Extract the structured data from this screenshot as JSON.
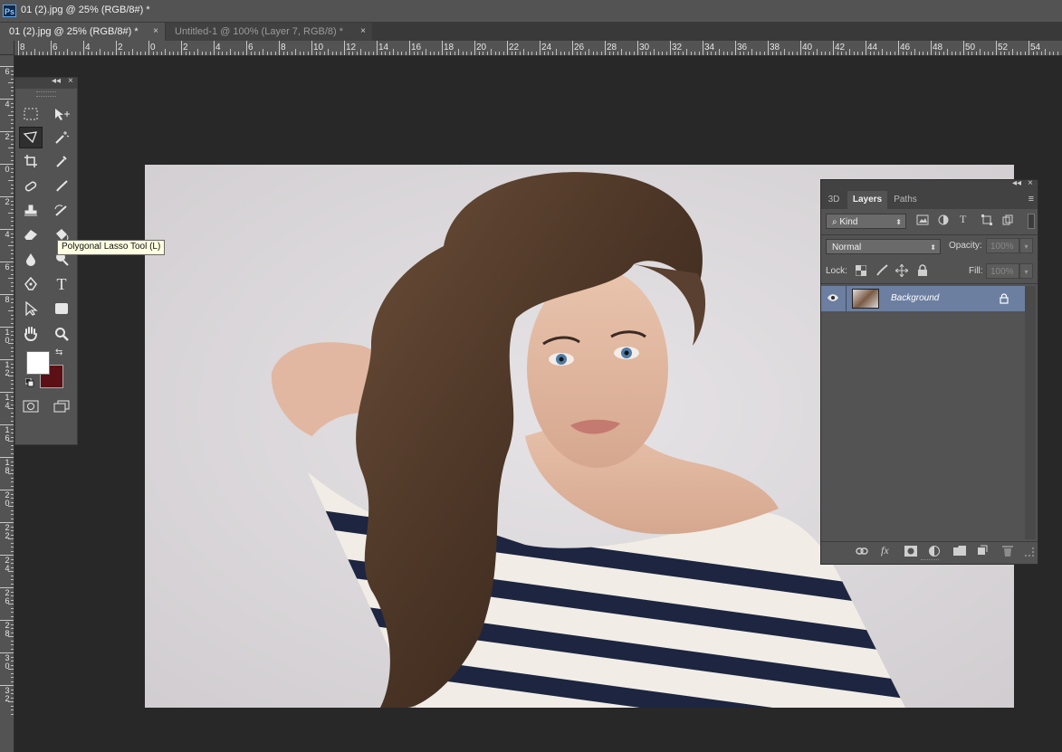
{
  "app": {
    "logo_text": "Ps",
    "window_title": "01 (2).jpg @ 25% (RGB/8#) *"
  },
  "tabs": [
    {
      "label": "01 (2).jpg @ 25% (RGB/8#) *",
      "close": "×",
      "active": true
    },
    {
      "label": "Untitled-1 @ 100% (Layer 7, RGB/8) *",
      "close": "×",
      "active": false
    }
  ],
  "rulers": {
    "top_labels": [
      "8",
      "6",
      "4",
      "2",
      "0",
      "2",
      "4",
      "6",
      "8",
      "10",
      "12",
      "14",
      "16",
      "18",
      "20",
      "22",
      "24",
      "26",
      "28",
      "30",
      "32",
      "34",
      "36",
      "38",
      "40",
      "42",
      "44",
      "46",
      "48",
      "50",
      "52",
      "54"
    ],
    "left_labels": [
      "6",
      "4",
      "2",
      "0",
      "2",
      "4",
      "6",
      "8",
      "1\n0",
      "1\n2",
      "1\n4",
      "1\n6",
      "1\n8",
      "2\n0",
      "2\n2",
      "2\n4",
      "2\n6",
      "2\n8",
      "3\n0",
      "3\n2"
    ]
  },
  "toolbox": {
    "collapse": "◂◂",
    "close": "×",
    "tooltip": "Polygonal Lasso Tool (L)",
    "tools": [
      {
        "name": "rectangular-marquee-tool",
        "glyph": "⬚"
      },
      {
        "name": "move-tool",
        "glyph": "✥"
      },
      {
        "name": "polygonal-lasso-tool",
        "glyph": "⌔",
        "selected": true
      },
      {
        "name": "magic-wand-tool",
        "glyph": "✲"
      },
      {
        "name": "crop-tool",
        "glyph": "⌗"
      },
      {
        "name": "eyedropper-tool",
        "glyph": "⸝"
      },
      {
        "name": "spot-healing-brush-tool",
        "glyph": "✚"
      },
      {
        "name": "brush-tool",
        "glyph": "✎"
      },
      {
        "name": "clone-stamp-tool",
        "glyph": "⊥"
      },
      {
        "name": "history-brush-tool",
        "glyph": "✎"
      },
      {
        "name": "eraser-tool",
        "glyph": "▱"
      },
      {
        "name": "paint-bucket-tool",
        "glyph": "◈"
      },
      {
        "name": "blur-tool",
        "glyph": "💧"
      },
      {
        "name": "dodge-tool",
        "glyph": "●"
      },
      {
        "name": "pen-tool",
        "glyph": "✒"
      },
      {
        "name": "type-tool",
        "glyph": "T"
      },
      {
        "name": "path-selection-tool",
        "glyph": "➤"
      },
      {
        "name": "rectangle-tool",
        "glyph": "▢"
      },
      {
        "name": "hand-tool",
        "glyph": "✋"
      },
      {
        "name": "zoom-tool",
        "glyph": "⚲"
      },
      {
        "name": "quick-mask-button",
        "glyph": "◎"
      },
      {
        "name": "screen-mode-button",
        "glyph": "❐"
      }
    ],
    "foreground_color": "#ffffff",
    "background_color": "#5a1014",
    "swap_glyph": "⇆"
  },
  "layers_panel": {
    "collapse": "◂◂",
    "close": "×",
    "tabs": [
      "3D",
      "Layers",
      "Paths"
    ],
    "active_tab": "Layers",
    "menu_glyph": "≡",
    "filter_kind": "Kind",
    "filter_search_glyph": "⌕",
    "blend_mode": "Normal",
    "opacity_label": "Opacity:",
    "opacity_value": "100%",
    "lock_label": "Lock:",
    "fill_label": "Fill:",
    "fill_value": "100%",
    "layer": {
      "name": "Background",
      "visible": true,
      "locked": true
    },
    "bottom_icons": [
      "link-layers-icon",
      "fx-icon",
      "add-mask-icon",
      "adjustment-layer-icon",
      "new-group-icon",
      "new-layer-icon",
      "delete-layer-icon"
    ],
    "fx_text": "fx"
  },
  "colors": {
    "app_bg": "#282828",
    "panel_bg": "#535353",
    "selected_layer": "#6c7fa1",
    "tooltip_bg": "#ffffe1"
  }
}
